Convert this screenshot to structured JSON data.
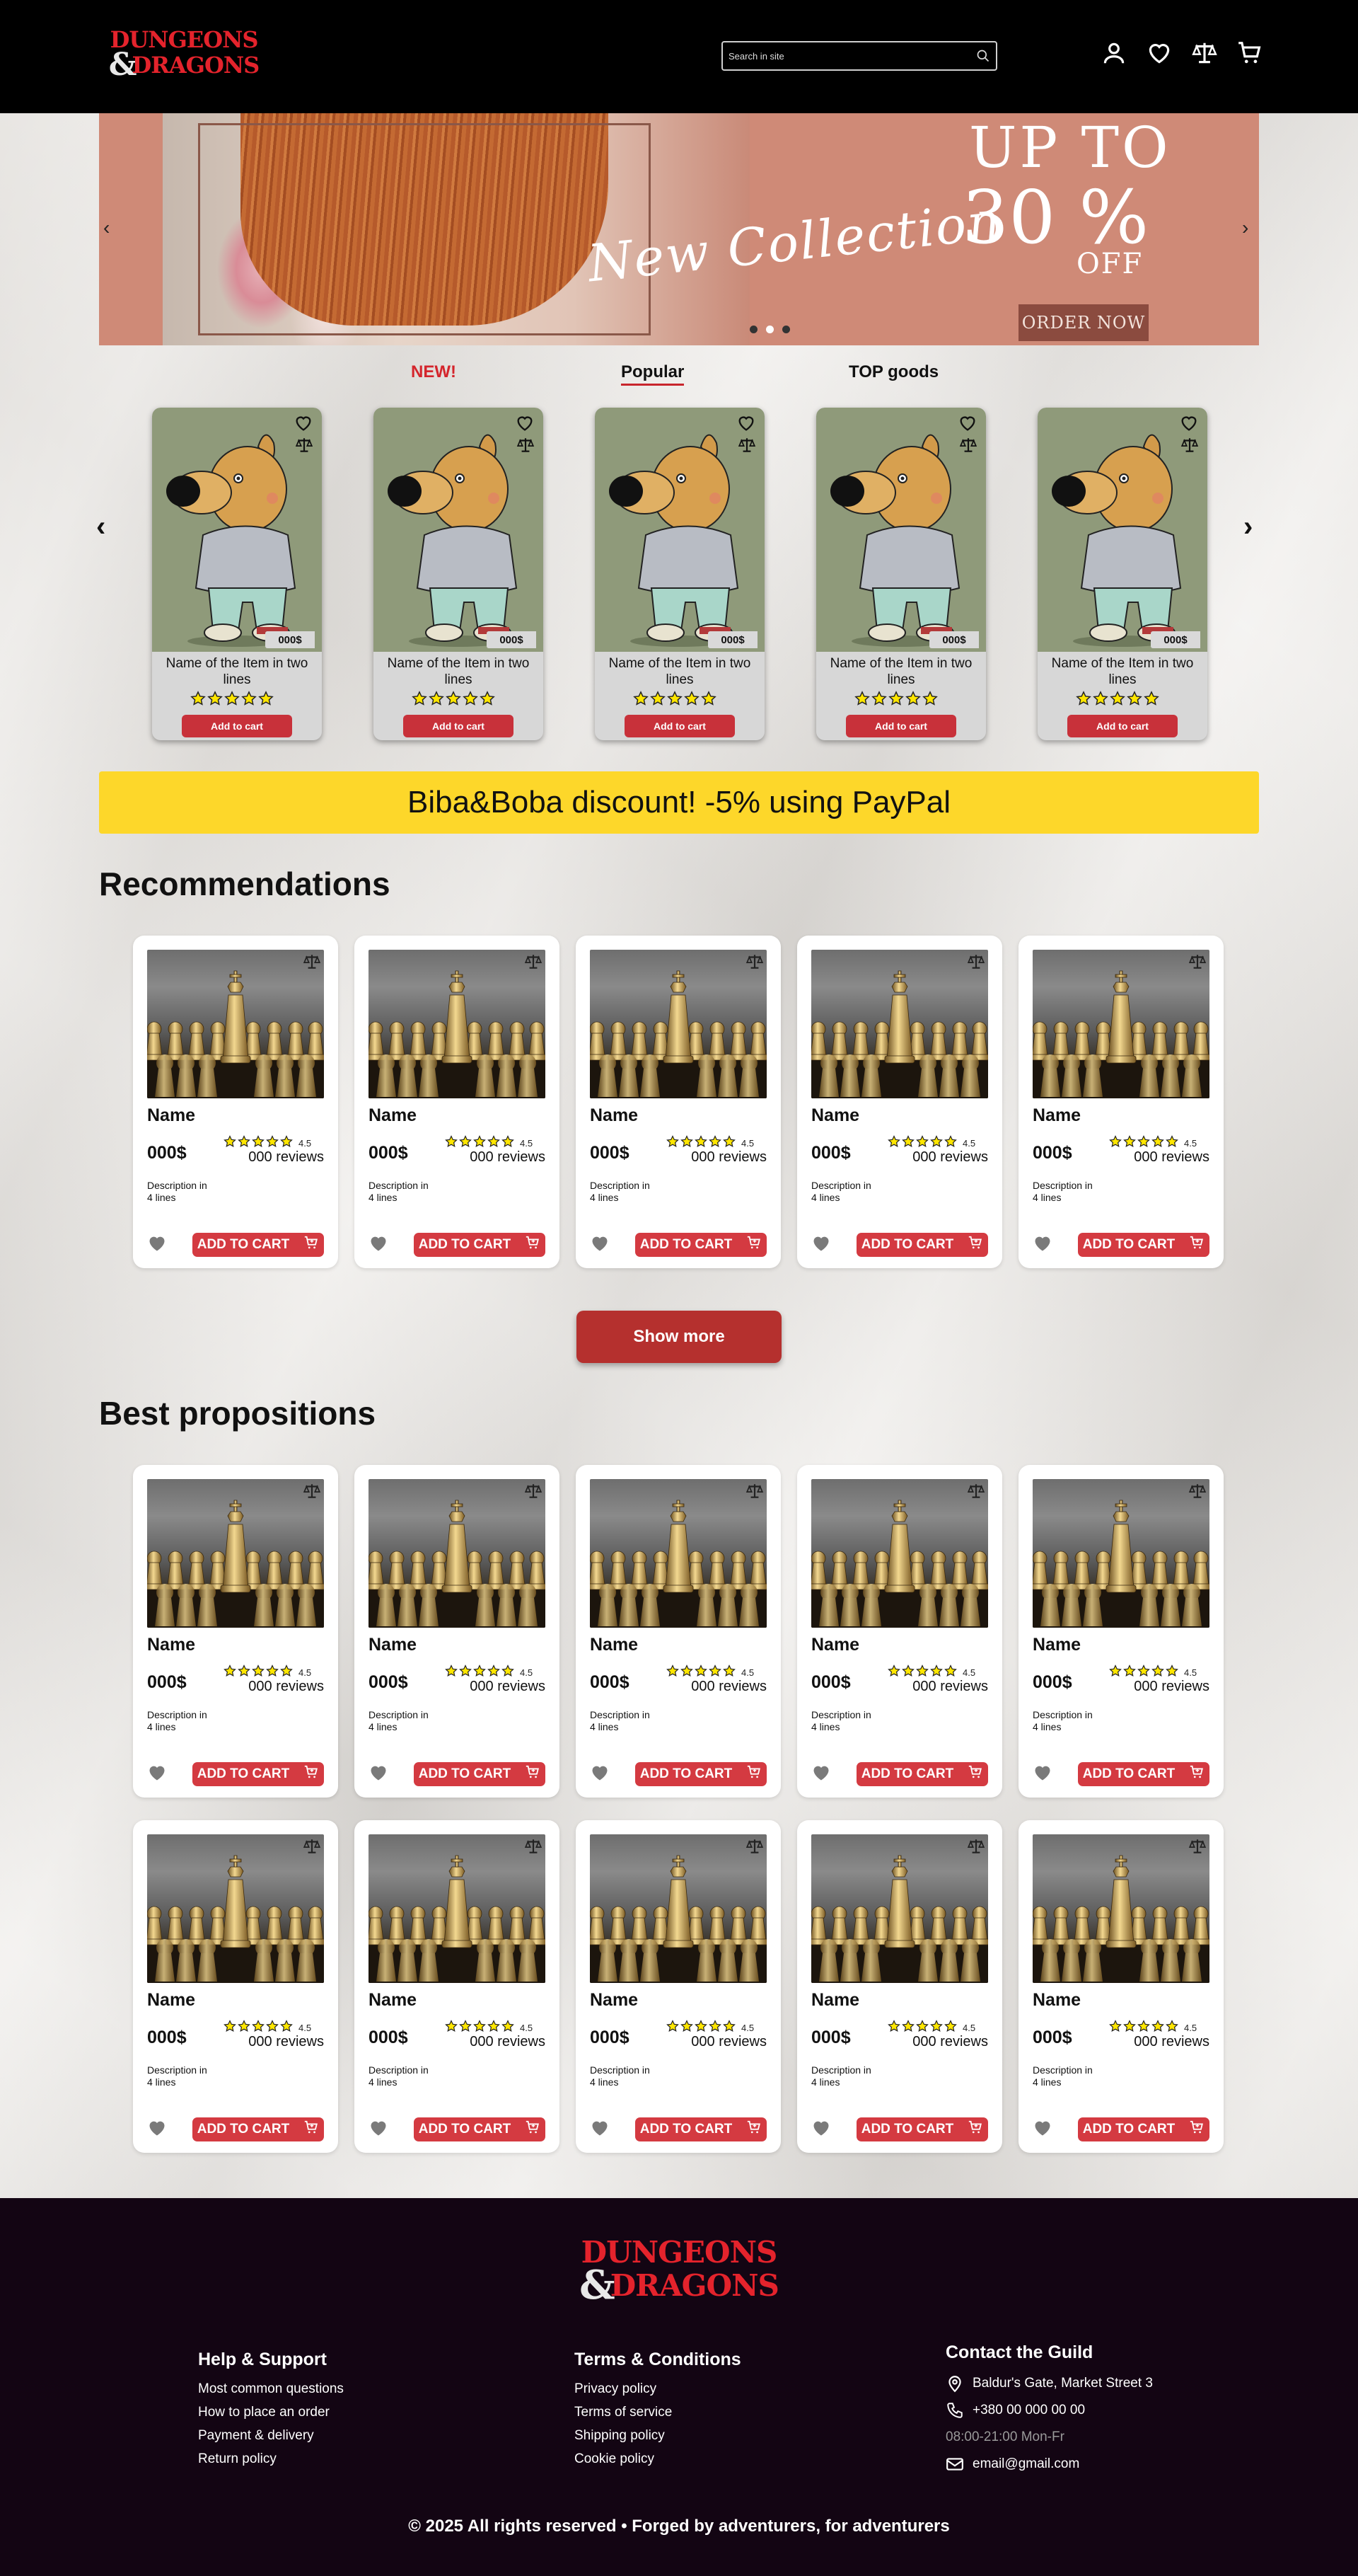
{
  "header": {
    "logo_line1": "DUNGEONS",
    "logo_amp": "&",
    "logo_line2": "DRAGONS",
    "search_placeholder": "Search in site"
  },
  "hero": {
    "script_text": "New Collection",
    "up_to": "UP TO",
    "percent": "30 %",
    "off": "OFF",
    "order": "ORDER NOW",
    "slides": 3,
    "active_slide": 1
  },
  "tabs": {
    "new": "NEW!",
    "popular": "Popular",
    "top": "TOP goods"
  },
  "featured": [
    {
      "name": "Name of the Item in two lines",
      "price": "000$",
      "button": "Add to cart",
      "rating": 5
    },
    {
      "name": "Name of the Item in two lines",
      "price": "000$",
      "button": "Add to cart",
      "rating": 5
    },
    {
      "name": "Name of the Item in two lines",
      "price": "000$",
      "button": "Add to cart",
      "rating": 5
    },
    {
      "name": "Name of the Item in two lines",
      "price": "000$",
      "button": "Add to cart",
      "rating": 5
    },
    {
      "name": "Name of the Item in two lines",
      "price": "000$",
      "button": "Add to cart",
      "rating": 5
    }
  ],
  "promo": "Biba&Boba discount! -5% using PayPal",
  "recommendations": {
    "title": "Recommendations",
    "show_more": "Show more"
  },
  "best": {
    "title": "Best propositions"
  },
  "product": {
    "name": "Name",
    "price": "000$",
    "rating": "4.5",
    "reviews": "000 reviews",
    "description": "Description in 4 lines",
    "button": "ADD TO CART"
  },
  "footer": {
    "help": {
      "title": "Help & Support",
      "links": [
        "Most common questions",
        "How to place an order",
        "Payment & delivery",
        "Return policy"
      ]
    },
    "terms": {
      "title": "Terms & Conditions",
      "links": [
        "Privacy policy",
        "Terms of service",
        "Shipping policy",
        "Cookie policy"
      ]
    },
    "contact": {
      "title": "Contact the Guild",
      "address": "Baldur's Gate, Market Street 3",
      "phone": "+380 00 000 00 00",
      "hours": "08:00-21:00 Mon-Fr",
      "email": "email@gmail.com"
    },
    "copyright": "© 2025 All rights reserved • Forged by adventurers, for adventurers"
  },
  "colors": {
    "accent_red": "#d43a41",
    "promo_yellow": "#fdd72a",
    "footer_bg": "#130513",
    "header_bg": "#000000"
  }
}
